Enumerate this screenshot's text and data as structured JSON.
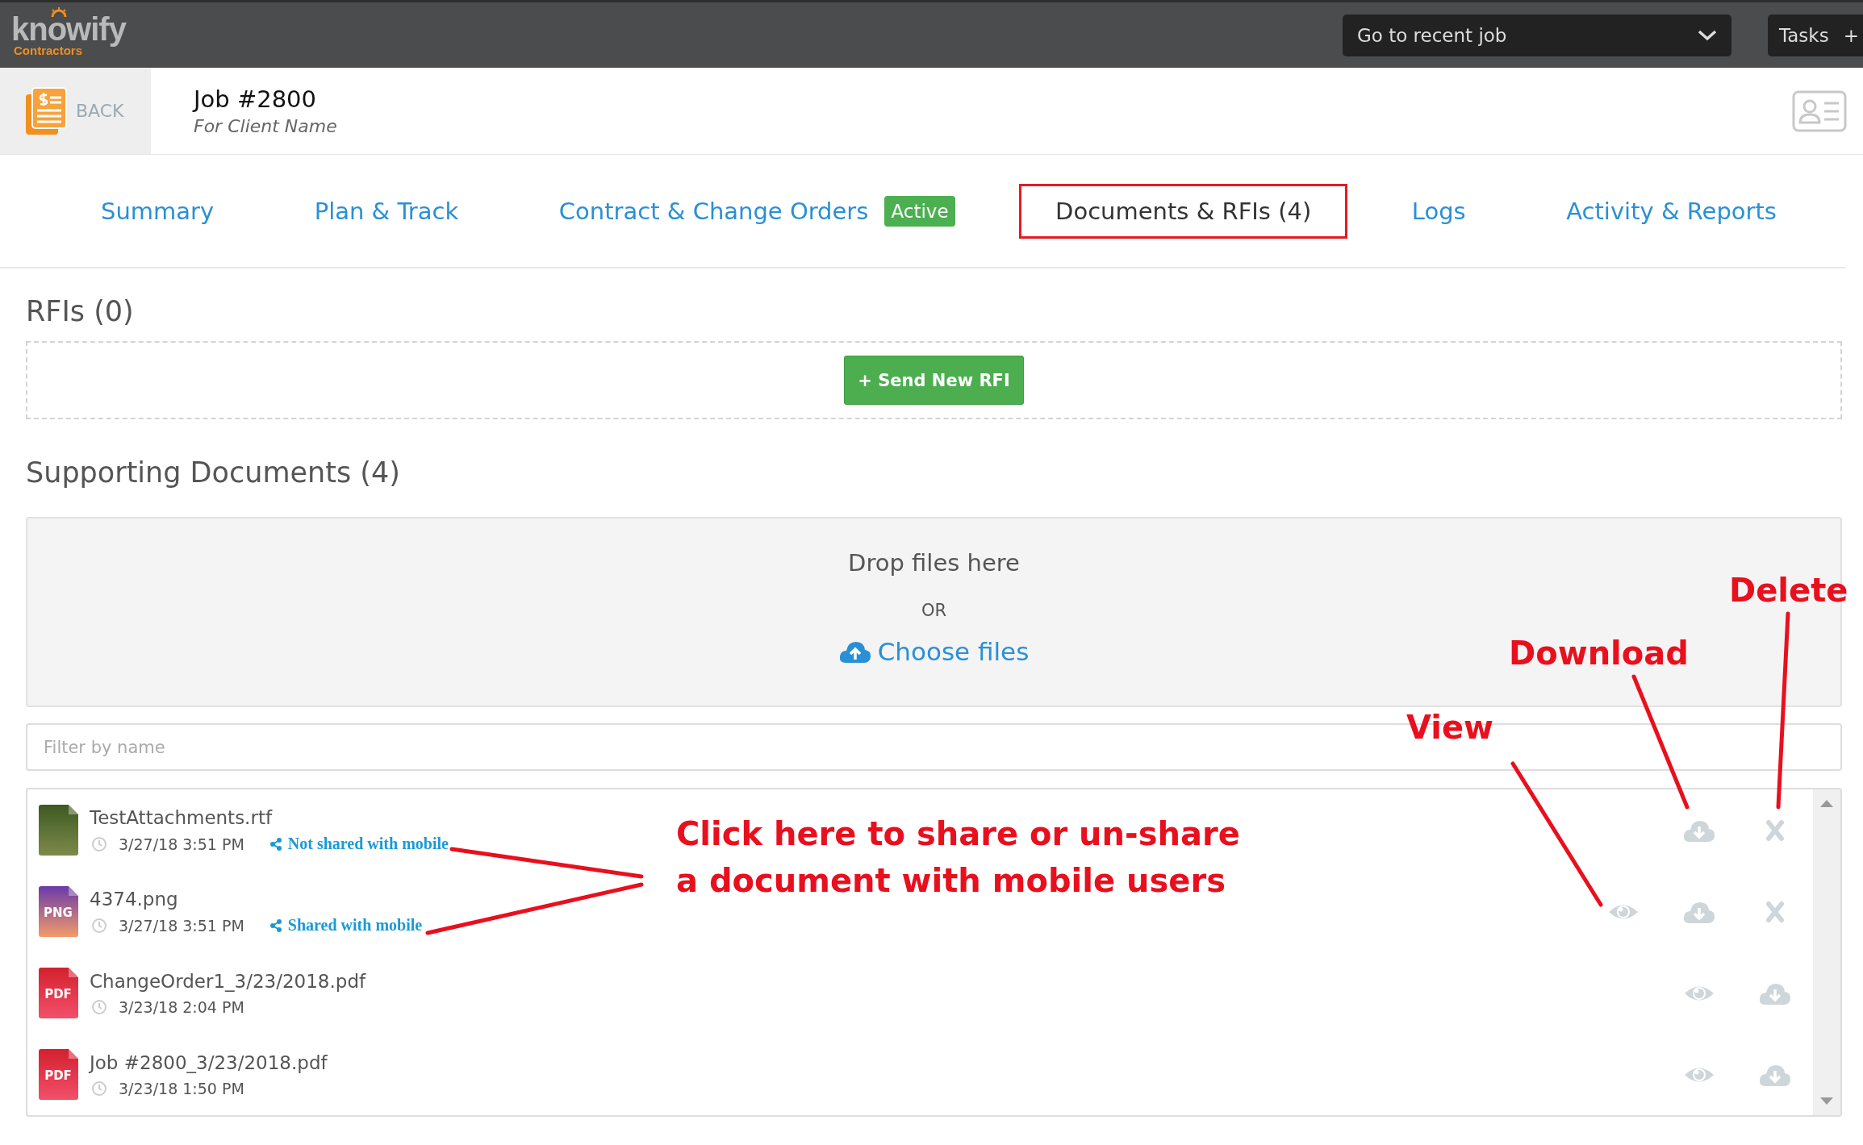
{
  "topbar": {
    "logo": "knowify",
    "logo_sub": "Contractors",
    "recent_job": "Go to recent job",
    "tasks": "Tasks",
    "tasks_plus": "+"
  },
  "header": {
    "back": "BACK",
    "title": "Job #2800",
    "subtitle": "For Client Name"
  },
  "tabs": [
    {
      "label": "Summary",
      "selected": false
    },
    {
      "label": "Plan & Track",
      "selected": false
    },
    {
      "label": "Contract & Change Orders",
      "badge": "Active",
      "selected": false
    },
    {
      "label": "Documents & RFIs (4)",
      "selected": true
    },
    {
      "label": "Logs",
      "selected": false
    },
    {
      "label": "Activity & Reports",
      "selected": false
    }
  ],
  "rfis": {
    "heading": "RFIs (0)",
    "button": "+ Send New RFI"
  },
  "documents": {
    "heading": "Supporting Documents (4)",
    "drop": "Drop files here",
    "or": "OR",
    "choose": "Choose files",
    "filter_placeholder": "Filter by name",
    "files": [
      {
        "kind": "rtf",
        "name": "TestAttachments.rtf",
        "date": "3/27/18 3:51 PM",
        "share": "Not shared with mobile",
        "actions": [
          {
            "kind": "download"
          },
          {
            "kind": "delete"
          }
        ]
      },
      {
        "kind": "png",
        "badge": "PNG",
        "name": "4374.png",
        "date": "3/27/18 3:51 PM",
        "share": "Shared with mobile",
        "actions": [
          {
            "kind": "view"
          },
          {
            "kind": "download"
          },
          {
            "kind": "delete"
          }
        ]
      },
      {
        "kind": "pdf",
        "badge": "PDF",
        "name": "ChangeOrder1_3/23/2018.pdf",
        "date": "3/23/18 2:04 PM",
        "actions": [
          {
            "kind": "view"
          },
          {
            "kind": "download"
          }
        ]
      },
      {
        "kind": "pdf",
        "badge": "PDF",
        "name": "Job #2800_3/23/2018.pdf",
        "date": "3/23/18 1:50 PM",
        "actions": [
          {
            "kind": "view"
          },
          {
            "kind": "download"
          }
        ]
      }
    ]
  },
  "annotations": [
    {
      "kind": "share",
      "text": "Click here to share or un-share a document with mobile users"
    },
    {
      "kind": "view",
      "text": "View"
    },
    {
      "kind": "download",
      "text": "Download"
    },
    {
      "kind": "delete",
      "text": "Delete"
    }
  ]
}
